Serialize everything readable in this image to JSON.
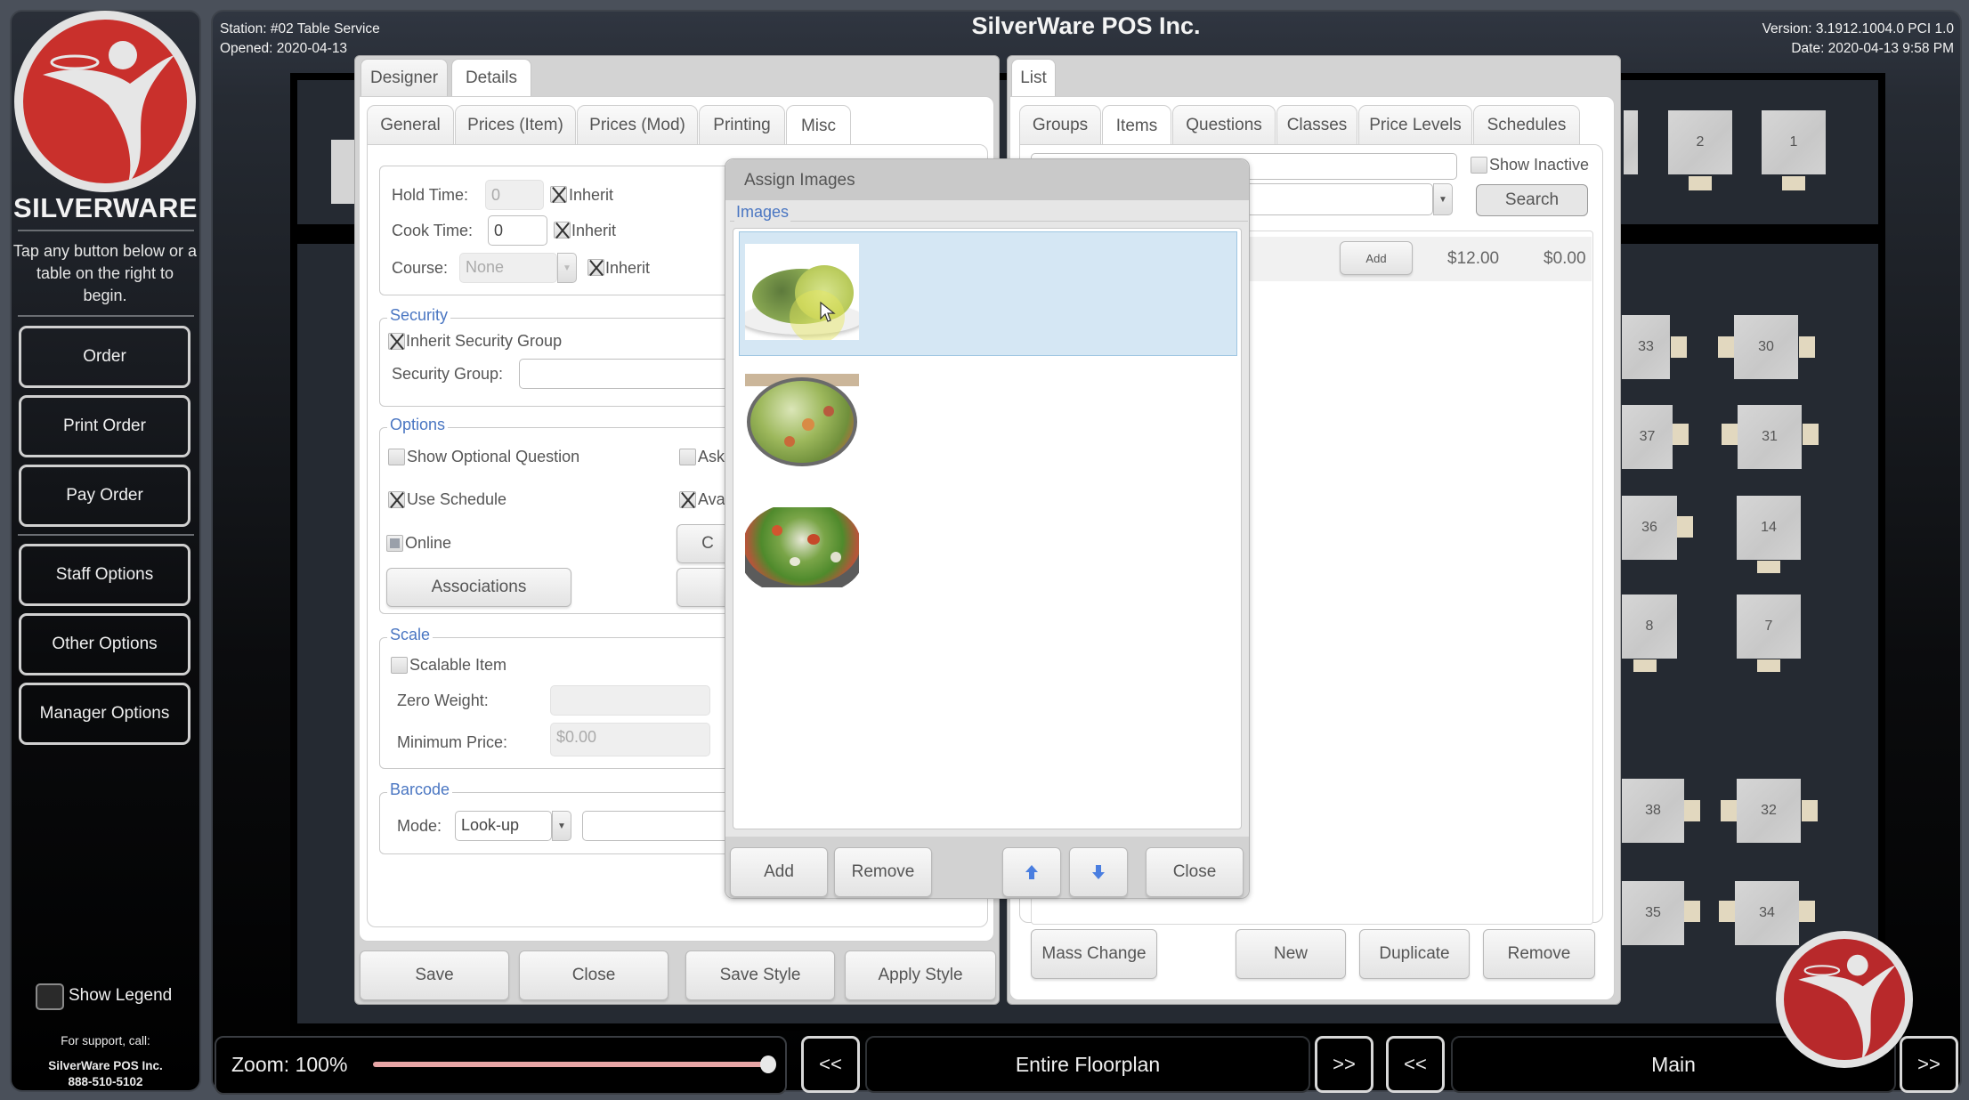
{
  "sidebar": {
    "brand": "SILVERWARE",
    "hint": "Tap any button below or a table on the right to begin.",
    "buttons": [
      "Order",
      "Print Order",
      "Pay Order",
      "Staff Options",
      "Other Options",
      "Manager Options"
    ],
    "show_legend_label": "Show Legend",
    "show_legend_checked": false,
    "support_label": "For support, call:",
    "support_company": "SilverWare POS Inc.",
    "support_phone": "888-510-5102"
  },
  "header": {
    "station": "Station: #02 Table Service",
    "opened": "Opened: 2020-04-13",
    "title": "SilverWare POS Inc.",
    "version": "Version: 3.1912.1004.0 PCI 1.0",
    "date": "Date: 2020-04-13 9:58 PM"
  },
  "editor": {
    "top_tabs": [
      {
        "label": "Designer",
        "active": false
      },
      {
        "label": "Details",
        "active": true
      }
    ],
    "sub_tabs": [
      {
        "label": "General",
        "active": false
      },
      {
        "label": "Prices (Item)",
        "active": false
      },
      {
        "label": "Prices (Mod)",
        "active": false
      },
      {
        "label": "Printing",
        "active": false
      },
      {
        "label": "Misc",
        "active": true
      }
    ],
    "timing": {
      "hold_time_label": "Hold Time:",
      "hold_time_value": "0",
      "hold_inherit_label": "Inherit",
      "hold_inherit_checked": true,
      "cook_time_label": "Cook Time:",
      "cook_time_value": "0",
      "cook_inherit_label": "Inherit",
      "cook_inherit_checked": true,
      "course_label": "Course:",
      "course_value": "None",
      "course_inherit_label": "Inherit",
      "course_inherit_checked": true
    },
    "security": {
      "title": "Security",
      "inherit_group_label": "Inherit Security Group",
      "inherit_group_checked": true,
      "group_label": "Security Group:",
      "group_value": ""
    },
    "options": {
      "title": "Options",
      "show_optional_question_label": "Show Optional Question",
      "show_optional_question_checked": false,
      "ask_label": "Ask",
      "ask_checked": false,
      "use_schedule_label": "Use Schedule",
      "use_schedule_checked": true,
      "ava_label": "Ava",
      "ava_checked": true,
      "online_label": "Online",
      "online_state": "indeterminate",
      "associations_label": "Associations",
      "partial_button_label": "C"
    },
    "scale": {
      "title": "Scale",
      "scalable_label": "Scalable Item",
      "scalable_checked": false,
      "zero_weight_label": "Zero Weight:",
      "zero_weight_value": "",
      "min_price_label": "Minimum Price:",
      "min_price_value": "$0.00"
    },
    "barcode": {
      "title": "Barcode",
      "mode_label": "Mode:",
      "mode_value": "Look-up",
      "code_value": ""
    },
    "footer_buttons": [
      "Save",
      "Close",
      "Save Style",
      "Apply Style"
    ]
  },
  "list_panel": {
    "top_tab": "List",
    "tabs": [
      {
        "label": "Groups",
        "active": false
      },
      {
        "label": "Items",
        "active": true
      },
      {
        "label": "Questions",
        "active": false
      },
      {
        "label": "Classes",
        "active": false
      },
      {
        "label": "Price Levels",
        "active": false
      },
      {
        "label": "Schedules",
        "active": false
      }
    ],
    "search_value": "",
    "show_inactive_label": "Show Inactive",
    "show_inactive_checked": false,
    "filter_value": "",
    "search_button": "Search",
    "rows": [
      {
        "add_label": "Add",
        "price": "$12.00",
        "price2": "$0.00"
      }
    ],
    "footer_buttons": {
      "mass_change": "Mass Change",
      "new": "New",
      "duplicate": "Duplicate",
      "remove": "Remove"
    }
  },
  "assign_images": {
    "title": "Assign Images",
    "group_title": "Images",
    "images": [
      {
        "name": "salad-1",
        "selected": true
      },
      {
        "name": "salad-2",
        "selected": false
      },
      {
        "name": "salad-3",
        "selected": false
      }
    ],
    "buttons": {
      "add": "Add",
      "remove": "Remove",
      "move_up": "move-up",
      "move_down": "move-down",
      "close": "Close"
    },
    "accent": "#4a76c2",
    "selection_color": "#d5e7f4"
  },
  "floorplan": {
    "tables": [
      "2",
      "1",
      "33",
      "30",
      "37",
      "31",
      "36",
      "14",
      "8",
      "7",
      "38",
      "32",
      "35",
      "34"
    ]
  },
  "bottom_bar": {
    "zoom_label": "Zoom: 100%",
    "zoom_value_percent": 100,
    "prev_label": "<<",
    "next_label": ">>",
    "area_label": "Entire Floorplan",
    "section_label": "Main"
  }
}
